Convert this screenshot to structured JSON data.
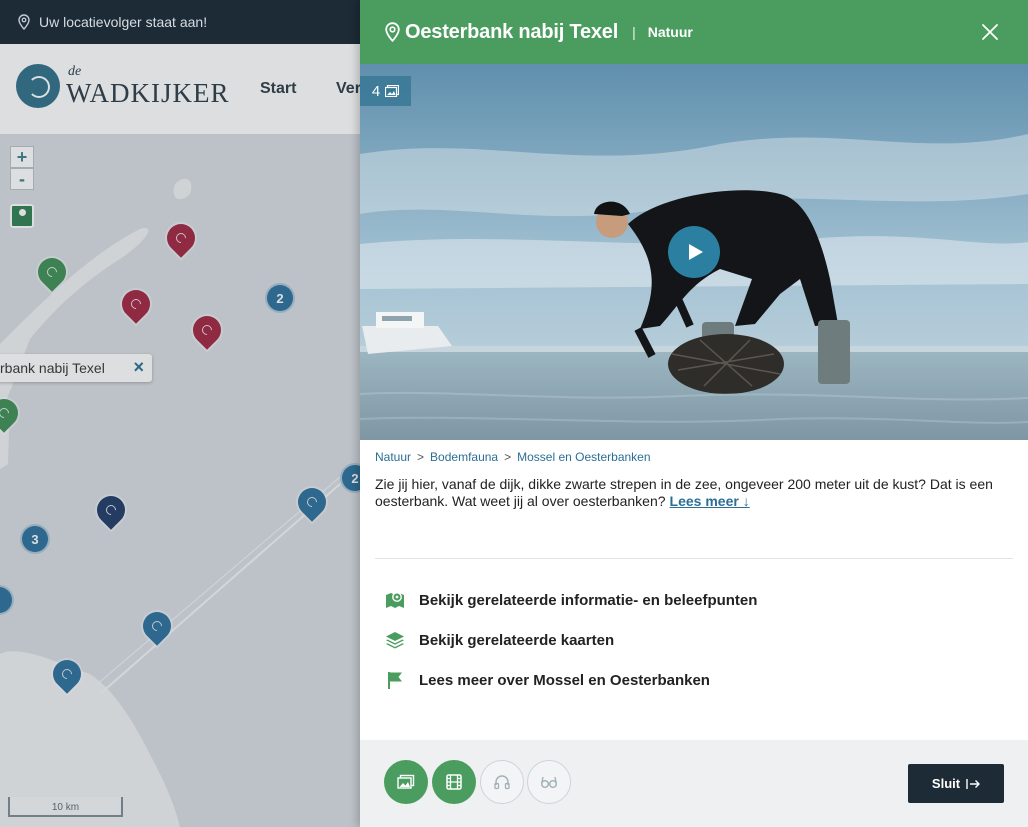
{
  "background": {
    "location_bar": {
      "text": "Uw locatievolger staat aan!"
    },
    "logo": {
      "small": "de",
      "name": "WADKIJKER"
    },
    "nav": [
      "Start",
      "Ver"
    ],
    "map": {
      "zoom_in": "+",
      "zoom_out": "-",
      "selected_label": "rbank nabij Texel",
      "selected_close": "×",
      "clusters": [
        "2",
        "2",
        "3"
      ],
      "scale": "10 km"
    }
  },
  "panel": {
    "title": "Oesterbank nabij Texel",
    "separator": "|",
    "category": "Natuur",
    "photo_count": "4",
    "breadcrumbs": [
      "Natuur",
      "Bodemfauna",
      "Mossel en Oesterbanken"
    ],
    "breadcrumb_sep": ">",
    "description": "Zie jij hier, vanaf de dijk, dikke zwarte strepen in de zee, ongeveer 200 meter uit de kust? Dat is een oesterbank. Wat weet jij al over oesterbanken?",
    "read_more": "Lees meer ↓",
    "links": [
      {
        "icon": "map-pin-icon",
        "label": "Bekijk gerelateerde informatie- en beleefpunten"
      },
      {
        "icon": "layers-icon",
        "label": "Bekijk gerelateerde kaarten"
      },
      {
        "icon": "flag-icon",
        "label": "Lees meer over Mossel en Oesterbanken"
      }
    ],
    "media_buttons": [
      {
        "icon": "image-icon",
        "active": true
      },
      {
        "icon": "film-icon",
        "active": true
      },
      {
        "icon": "headphones-icon",
        "active": false
      },
      {
        "icon": "glasses-icon",
        "active": false
      }
    ],
    "close_button": "Sluit"
  },
  "colors": {
    "header_green": "#4b9d5f",
    "dark_navy": "#1c2b36",
    "link_blue": "#2b6f95",
    "pin_red": "#a3233f",
    "pin_green": "#3f8f55",
    "pin_blue": "#2b6f9b"
  }
}
